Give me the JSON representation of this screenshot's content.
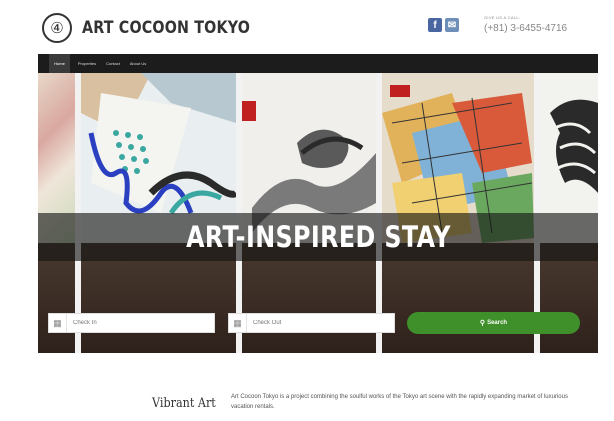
{
  "site": {
    "brand_name": "ART COCOON TOKYO",
    "logo_glyph": "④",
    "contact_label": "GIVE US A CALL:",
    "phone": "(+81) 3-6455-4716",
    "social": [
      {
        "name": "facebook",
        "glyph": "f",
        "color": "#4a66a0"
      },
      {
        "name": "email",
        "glyph": "✉",
        "color": "#6e8fb8"
      }
    ]
  },
  "nav": {
    "items": [
      {
        "label": "Home",
        "active": true
      },
      {
        "label": "Properties",
        "active": false
      },
      {
        "label": "Contact",
        "active": false
      },
      {
        "label": "About Us",
        "active": false
      }
    ]
  },
  "hero": {
    "title": "ART-INSPIRED STAY"
  },
  "booking": {
    "check_in_placeholder": "Check In",
    "check_out_placeholder": "Check Out",
    "search_label": "Search",
    "accent_color": "#3f8f2a"
  },
  "intro": {
    "title": "Vibrant Art",
    "text": "Art Cocoon Tokyo is a project combining the soulful works of the Tokyo art scene with the rapidly expanding market of luxurious vacation rentals."
  }
}
